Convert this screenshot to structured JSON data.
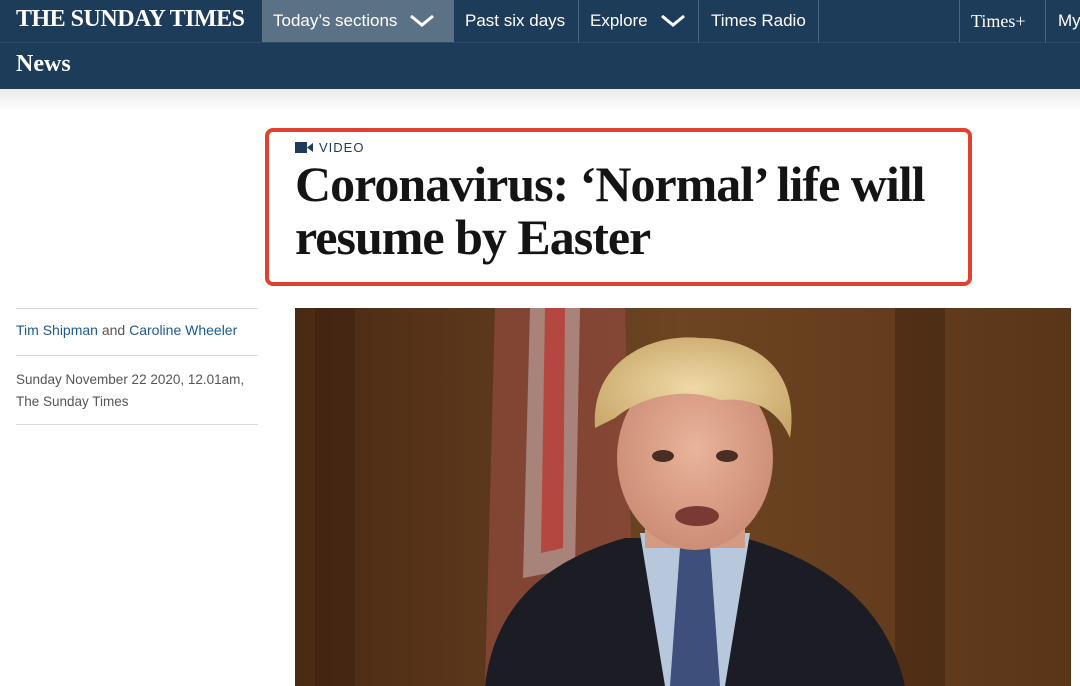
{
  "nav": {
    "masthead": "THE SUNDAY TIMES",
    "items": [
      {
        "label": "Today’s sections"
      },
      {
        "label": "Past six days"
      },
      {
        "label": "Explore"
      },
      {
        "label": "Times Radio"
      }
    ],
    "times_plus": "Times+",
    "my_account": "My"
  },
  "section": {
    "title": "News"
  },
  "article": {
    "tag": "VIDEO",
    "headline": "Coronavirus: ‘Normal’ life will resume by Easter",
    "authors": [
      "Tim Shipman",
      "Caroline Wheeler"
    ],
    "author_joiner": "and",
    "date": "Sunday November 22 2020, 12.01am,",
    "publication": "The Sunday Times"
  },
  "colors": {
    "nav_bg": "#1d3c5a",
    "highlight_border": "#e3412f",
    "author_link": "#1b5a8e"
  },
  "icons": [
    "chevron-down-icon",
    "video-camera-icon"
  ]
}
